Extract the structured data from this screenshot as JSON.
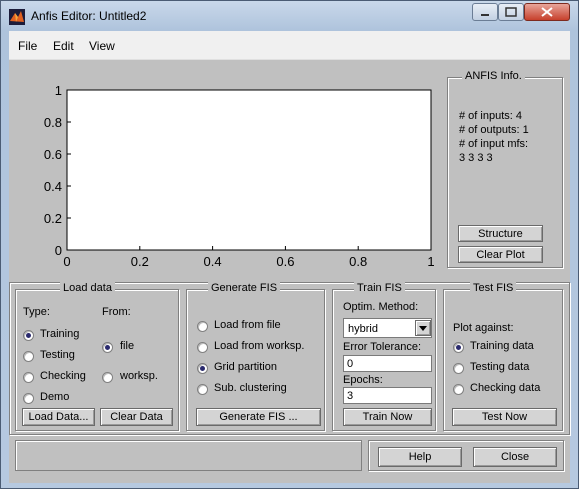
{
  "window": {
    "title": "Anfis Editor: Untitled2"
  },
  "menu": {
    "file": "File",
    "edit": "Edit",
    "view": "View"
  },
  "chart_data": {
    "type": "line",
    "series": [],
    "xlim": [
      0,
      1
    ],
    "ylim": [
      0,
      1
    ],
    "xticks": [
      "0",
      "0.2",
      "0.4",
      "0.6",
      "0.8",
      "1"
    ],
    "yticks": [
      "0",
      "0.2",
      "0.4",
      "0.6",
      "0.8",
      "1"
    ]
  },
  "info": {
    "title": "ANFIS Info.",
    "inputs": "# of inputs: 4",
    "outputs": "# of outputs: 1",
    "mfs_label": "# of input mfs:",
    "mfs_values": "3  3  3  3",
    "structure_btn": "Structure",
    "clear_plot_btn": "Clear Plot"
  },
  "load": {
    "title": "Load data",
    "type_label": "Type:",
    "from_label": "From:",
    "types": [
      "Training",
      "Testing",
      "Checking",
      "Demo"
    ],
    "type_selected": 0,
    "sources": [
      "file",
      "worksp."
    ],
    "source_selected": 0,
    "load_btn": "Load Data...",
    "clear_btn": "Clear Data"
  },
  "generate": {
    "title": "Generate FIS",
    "options": [
      "Load from file",
      "Load from worksp.",
      "Grid partition",
      "Sub. clustering"
    ],
    "selected": 2,
    "btn": "Generate FIS ..."
  },
  "train": {
    "title": "Train FIS",
    "method_label": "Optim. Method:",
    "method_value": "hybrid",
    "tol_label": "Error Tolerance:",
    "tol_value": "0",
    "epochs_label": "Epochs:",
    "epochs_value": "3",
    "btn": "Train Now"
  },
  "test": {
    "title": "Test FIS",
    "plot_label": "Plot against:",
    "options": [
      "Training data",
      "Testing data",
      "Checking data"
    ],
    "selected": 0,
    "btn": "Test Now"
  },
  "footer": {
    "help": "Help",
    "close": "Close"
  }
}
